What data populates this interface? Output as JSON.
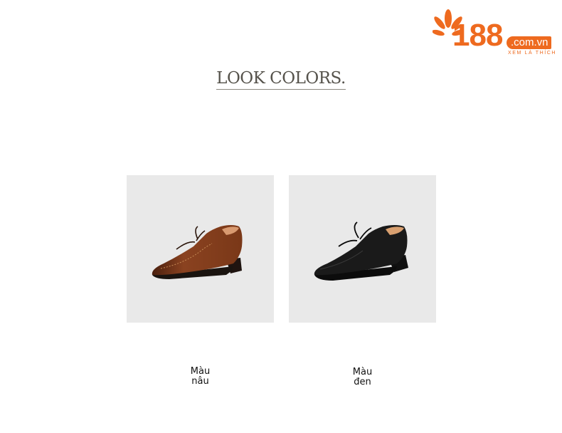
{
  "logo": {
    "number": "188",
    "domain": ".com.vn",
    "tagline": "XEM LÀ THÍCH",
    "color": "#ee6a1f"
  },
  "heading": "LOOK COLORS.",
  "products": [
    {
      "label": "Màu nâu",
      "color_name": "brown",
      "shoe_color": "#7a3a1a"
    },
    {
      "label": "Màu đen",
      "color_name": "black",
      "shoe_color": "#141414"
    }
  ]
}
